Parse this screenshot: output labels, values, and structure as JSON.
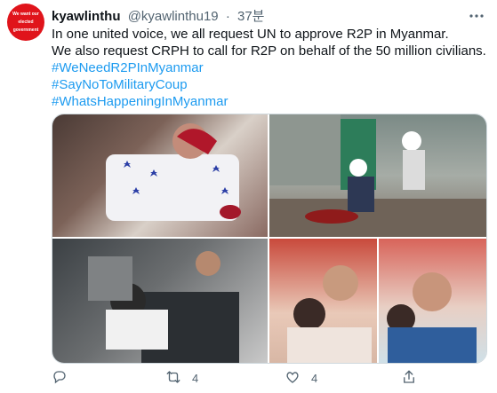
{
  "tweet": {
    "avatar_text_line1": "We want our",
    "avatar_text_line2": "elected government",
    "display_name": "kyawlinthu",
    "handle": "@kyawlinthu19",
    "separator": "·",
    "time": "37분",
    "lines": [
      "In one united voice, we all request UN to approve R2P in Myanmar.",
      "We also request CRPH to call for R2P on behalf of the 50 million civilians."
    ],
    "hashtags": [
      "#WeNeedR2PInMyanmar",
      "#SayNoToMilitaryCoup",
      "#WhatsHappeningInMyanmar"
    ],
    "actions": {
      "reply_icon": "reply-icon",
      "retweet_icon": "retweet-icon",
      "retweet_count": "4",
      "like_icon": "heart-icon",
      "like_count": "4",
      "share_icon": "share-icon"
    }
  },
  "colors": {
    "link": "#1d9bf0",
    "secondary": "#536471",
    "avatar": "#e0141b"
  }
}
